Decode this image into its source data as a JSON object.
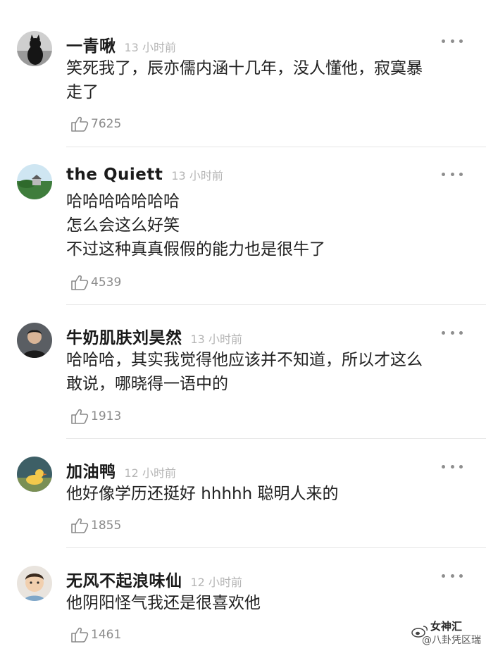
{
  "comments": [
    {
      "username": "一青啾",
      "time": "13 小时前",
      "text": "笑死我了，辰亦儒内涵十几年，没人懂他，寂寞暴\n走了",
      "likes": "7625",
      "avatar": "black-cat-avatar"
    },
    {
      "username": "the Quiett",
      "time": "13 小时前",
      "text": "哈哈哈哈哈哈哈\n怎么会这么好笑\n不过这种真真假假的能力也是很牛了",
      "likes": "4539",
      "avatar": "landscape-avatar"
    },
    {
      "username": "牛奶肌肤刘昊然",
      "time": "13 小时前",
      "text": "哈哈哈，其实我觉得他应该并不知道，所以才这么\n敢说，哪晓得一语中的",
      "likes": "1913",
      "avatar": "man-portrait-avatar"
    },
    {
      "username": "加油鸭",
      "time": "12 小时前",
      "text": "他好像学历还挺好 hhhhh 聪明人来的",
      "likes": "1855",
      "avatar": "duck-avatar"
    },
    {
      "username": "无风不起浪味仙",
      "time": "12 小时前",
      "text": "他阴阳怪气我还是很喜欢他",
      "likes": "1461",
      "avatar": "child-portrait-avatar"
    }
  ],
  "watermark": {
    "title": "女神汇",
    "subtitle": "@八卦凭区瑞"
  },
  "colors": {
    "text": "#222222",
    "muted": "#b5b5b5",
    "divider": "#e6e6e6"
  }
}
